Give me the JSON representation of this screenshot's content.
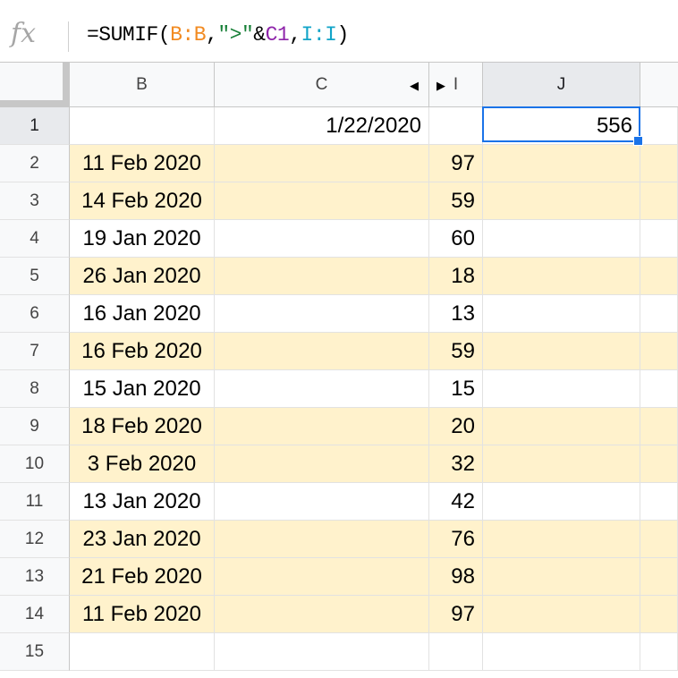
{
  "formula_bar": {
    "fx_label": "fx",
    "formula_parts": [
      {
        "text": "=SUMIF(",
        "color": "#000000"
      },
      {
        "text": "B:B",
        "color": "#f28b22"
      },
      {
        "text": ",",
        "color": "#000000"
      },
      {
        "text": "\">\"",
        "color": "#188038"
      },
      {
        "text": "&",
        "color": "#000000"
      },
      {
        "text": "C1",
        "color": "#8e24aa"
      },
      {
        "text": ",",
        "color": "#000000"
      },
      {
        "text": "I:I",
        "color": "#12a4c8"
      },
      {
        "text": ")",
        "color": "#000000"
      }
    ]
  },
  "columns": [
    "B",
    "C",
    "I",
    "J"
  ],
  "hidden_arrows": {
    "left": "◀",
    "right": "▶"
  },
  "colors": {
    "highlight": "#fff2cc",
    "selection": "#1a73e8"
  },
  "rows": [
    {
      "num": "1",
      "b": "",
      "c": "1/22/2020",
      "i": "",
      "j": "556",
      "highlight": false
    },
    {
      "num": "2",
      "b": "11 Feb 2020",
      "c": "",
      "i": "97",
      "j": "",
      "highlight": true
    },
    {
      "num": "3",
      "b": "14 Feb 2020",
      "c": "",
      "i": "59",
      "j": "",
      "highlight": true
    },
    {
      "num": "4",
      "b": "19 Jan 2020",
      "c": "",
      "i": "60",
      "j": "",
      "highlight": false
    },
    {
      "num": "5",
      "b": "26 Jan 2020",
      "c": "",
      "i": "18",
      "j": "",
      "highlight": true
    },
    {
      "num": "6",
      "b": "16 Jan 2020",
      "c": "",
      "i": "13",
      "j": "",
      "highlight": false
    },
    {
      "num": "7",
      "b": "16 Feb 2020",
      "c": "",
      "i": "59",
      "j": "",
      "highlight": true
    },
    {
      "num": "8",
      "b": "15 Jan 2020",
      "c": "",
      "i": "15",
      "j": "",
      "highlight": false
    },
    {
      "num": "9",
      "b": "18 Feb 2020",
      "c": "",
      "i": "20",
      "j": "",
      "highlight": true
    },
    {
      "num": "10",
      "b": "3 Feb 2020",
      "c": "",
      "i": "32",
      "j": "",
      "highlight": true
    },
    {
      "num": "11",
      "b": "13 Jan 2020",
      "c": "",
      "i": "42",
      "j": "",
      "highlight": false
    },
    {
      "num": "12",
      "b": "23 Jan 2020",
      "c": "",
      "i": "76",
      "j": "",
      "highlight": true
    },
    {
      "num": "13",
      "b": "21 Feb 2020",
      "c": "",
      "i": "98",
      "j": "",
      "highlight": true
    },
    {
      "num": "14",
      "b": "11 Feb 2020",
      "c": "",
      "i": "97",
      "j": "",
      "highlight": true
    },
    {
      "num": "15",
      "b": "",
      "c": "",
      "i": "",
      "j": "",
      "highlight": false
    }
  ],
  "selected_cell": "J1"
}
